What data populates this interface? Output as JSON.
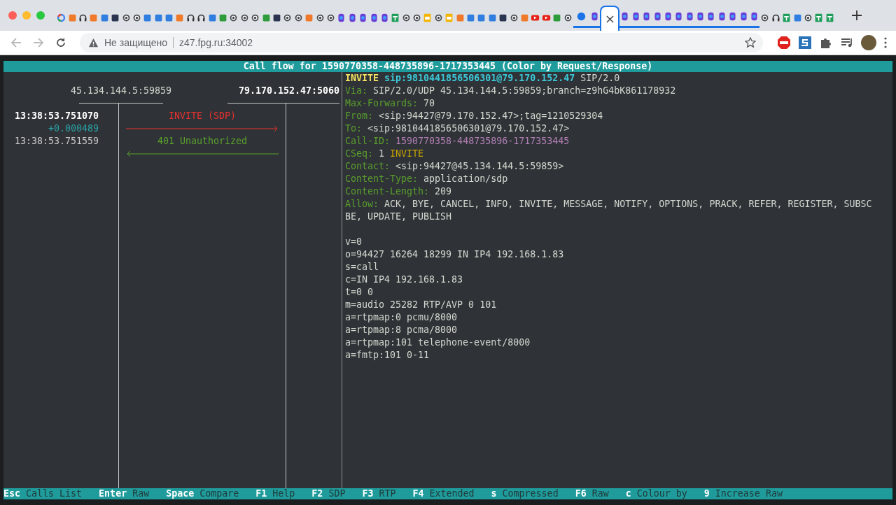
{
  "browser": {
    "tabs": [
      {
        "kind": "google",
        "selected": false,
        "grouped": false
      },
      {
        "kind": "orange",
        "selected": false,
        "grouped": false
      },
      {
        "kind": "headphones",
        "selected": false,
        "grouped": false
      },
      {
        "kind": "orange",
        "selected": false,
        "grouped": false
      },
      {
        "kind": "blue",
        "selected": false,
        "grouped": false
      },
      {
        "kind": "dark",
        "selected": false,
        "grouped": false
      },
      {
        "kind": "swirl",
        "selected": false,
        "grouped": false
      },
      {
        "kind": "swirl",
        "selected": false,
        "grouped": false
      },
      {
        "kind": "blue",
        "selected": false,
        "grouped": false
      },
      {
        "kind": "blue",
        "selected": false,
        "grouped": false
      },
      {
        "kind": "blue",
        "selected": false,
        "grouped": false
      },
      {
        "kind": "orange",
        "selected": false,
        "grouped": false
      },
      {
        "kind": "headphones",
        "selected": false,
        "grouped": false
      },
      {
        "kind": "headphones",
        "selected": false,
        "grouped": false
      },
      {
        "kind": "blue",
        "selected": false,
        "grouped": false
      },
      {
        "kind": "green",
        "selected": false,
        "grouped": false
      },
      {
        "kind": "swirl",
        "selected": false,
        "grouped": false
      },
      {
        "kind": "swirl",
        "selected": false,
        "grouped": false
      },
      {
        "kind": "swirl",
        "selected": false,
        "grouped": false
      },
      {
        "kind": "green",
        "selected": false,
        "grouped": false
      },
      {
        "kind": "dark",
        "selected": false,
        "grouped": false
      },
      {
        "kind": "swirl",
        "selected": false,
        "grouped": false
      },
      {
        "kind": "swirl",
        "selected": false,
        "grouped": false
      },
      {
        "kind": "orange",
        "selected": false,
        "grouped": false
      },
      {
        "kind": "swirl",
        "selected": false,
        "grouped": false
      },
      {
        "kind": "swirl",
        "selected": false,
        "grouped": false
      },
      {
        "kind": "purple",
        "selected": false,
        "grouped": false
      },
      {
        "kind": "purple",
        "selected": false,
        "grouped": false
      },
      {
        "kind": "purple",
        "selected": false,
        "grouped": false
      },
      {
        "kind": "purple",
        "selected": false,
        "grouped": false
      },
      {
        "kind": "purple",
        "selected": false,
        "grouped": false
      },
      {
        "kind": "sheet",
        "selected": false,
        "grouped": false
      },
      {
        "kind": "swirl",
        "selected": false,
        "grouped": false
      },
      {
        "kind": "swirl",
        "selected": false,
        "grouped": false
      },
      {
        "kind": "slide",
        "selected": false,
        "grouped": false
      },
      {
        "kind": "swirl",
        "selected": false,
        "grouped": false
      },
      {
        "kind": "slide",
        "selected": false,
        "grouped": false
      },
      {
        "kind": "orange",
        "selected": false,
        "grouped": false
      },
      {
        "kind": "blue",
        "selected": false,
        "grouped": false
      },
      {
        "kind": "blue",
        "selected": false,
        "grouped": false
      },
      {
        "kind": "blue",
        "selected": false,
        "grouped": false
      },
      {
        "kind": "dark",
        "selected": false,
        "grouped": false
      },
      {
        "kind": "swirl",
        "selected": false,
        "grouped": false
      },
      {
        "kind": "orange",
        "selected": false,
        "grouped": false
      },
      {
        "kind": "youtube",
        "selected": false,
        "grouped": false
      },
      {
        "kind": "youtube",
        "selected": false,
        "grouped": false
      },
      {
        "kind": "green",
        "selected": false,
        "grouped": false
      },
      {
        "kind": "swirl",
        "selected": false,
        "grouped": false
      },
      {
        "kind": "dot",
        "selected": false,
        "grouped": true
      },
      {
        "kind": "purple",
        "selected": false,
        "grouped": true
      },
      {
        "kind": "purple",
        "selected": true,
        "grouped": true
      },
      {
        "kind": "purple",
        "selected": false,
        "grouped": true
      },
      {
        "kind": "purple",
        "selected": false,
        "grouped": true
      },
      {
        "kind": "purple",
        "selected": false,
        "grouped": true
      },
      {
        "kind": "purple",
        "selected": false,
        "grouped": true
      },
      {
        "kind": "purple",
        "selected": false,
        "grouped": true
      },
      {
        "kind": "purple",
        "selected": false,
        "grouped": true
      },
      {
        "kind": "purple",
        "selected": false,
        "grouped": true
      },
      {
        "kind": "purple",
        "selected": false,
        "grouped": true
      },
      {
        "kind": "purple",
        "selected": false,
        "grouped": true
      },
      {
        "kind": "purple",
        "selected": false,
        "grouped": true
      },
      {
        "kind": "purple",
        "selected": false,
        "grouped": true
      },
      {
        "kind": "purple",
        "selected": false,
        "grouped": true
      },
      {
        "kind": "purple",
        "selected": false,
        "grouped": true
      },
      {
        "kind": "swirl",
        "selected": false,
        "grouped": false
      },
      {
        "kind": "headphones",
        "selected": false,
        "grouped": false
      },
      {
        "kind": "sheet",
        "selected": false,
        "grouped": false
      },
      {
        "kind": "blue",
        "selected": false,
        "grouped": false
      },
      {
        "kind": "swirl",
        "selected": false,
        "grouped": false
      },
      {
        "kind": "sheet",
        "selected": false,
        "grouped": false
      },
      {
        "kind": "sheet",
        "selected": false,
        "grouped": false
      }
    ],
    "address_bar": {
      "security_label": "Не защищено",
      "url": "z47.fpg.ru:34002"
    }
  },
  "terminal": {
    "title": "Call flow for 1590770358-448735896-1717353445 (Color by Request/Response)",
    "hosts": [
      {
        "address": "45.134.144.5:59859",
        "selected": false
      },
      {
        "address": "79.170.152.47:5060",
        "selected": true
      }
    ],
    "messages": [
      {
        "time": "13:38:53.751070",
        "delta": "+0.000489",
        "label": "INVITE (SDP)",
        "kind": "request",
        "color": "#e8302f",
        "selected": true
      },
      {
        "time": "13:38:53.751559",
        "label": "401 Unauthorized",
        "kind": "response",
        "color": "#5aa02c",
        "selected": false
      }
    ],
    "sip_lines": [
      [
        {
          "kind": "method",
          "text": "INVITE"
        },
        {
          "kind": "uri",
          "text": "sip:9810441856506301@79.170.152.47"
        },
        {
          "kind": "value",
          "text": "SIP/2.0"
        }
      ],
      [
        {
          "kind": "header",
          "text": "Via:"
        },
        {
          "kind": "value",
          "text": "SIP/2.0/UDP 45.134.144.5:59859;branch=z9hG4bK861178932"
        }
      ],
      [
        {
          "kind": "header",
          "text": "Max-Forwards:"
        },
        {
          "kind": "value",
          "text": "70"
        }
      ],
      [
        {
          "kind": "header",
          "text": "From:"
        },
        {
          "kind": "value",
          "text": "<sip:94427@79.170.152.47>;tag=1210529304"
        }
      ],
      [
        {
          "kind": "header",
          "text": "To:"
        },
        {
          "kind": "value",
          "text": "<sip:9810441856506301@79.170.152.47>"
        }
      ],
      [
        {
          "kind": "header",
          "text": "Call-ID:"
        },
        {
          "kind": "callid",
          "text": "1590770358-448735896-1717353445"
        }
      ],
      [
        {
          "kind": "header",
          "text": "CSeq:"
        },
        {
          "kind": "value",
          "text": "1"
        },
        {
          "kind": "cseq_method",
          "text": "INVITE"
        }
      ],
      [
        {
          "kind": "header",
          "text": "Contact:"
        },
        {
          "kind": "value",
          "text": "<sip:94427@45.134.144.5:59859>"
        }
      ],
      [
        {
          "kind": "header",
          "text": "Content-Type:"
        },
        {
          "kind": "value",
          "text": "application/sdp"
        }
      ],
      [
        {
          "kind": "header",
          "text": "Content-Length:"
        },
        {
          "kind": "value",
          "text": "209"
        }
      ],
      [
        {
          "kind": "header",
          "text": "Allow:"
        },
        {
          "kind": "value",
          "text": "ACK, BYE, CANCEL, INFO, INVITE, MESSAGE, NOTIFY, OPTIONS, PRACK, REFER, REGISTER, SUBSC"
        }
      ],
      [
        {
          "kind": "value",
          "text": "BE, UPDATE, PUBLISH"
        }
      ],
      [
        {
          "kind": "blank"
        }
      ],
      [
        {
          "kind": "value",
          "text": "v=0"
        }
      ],
      [
        {
          "kind": "value",
          "text": "o=94427 16264 18299 IN IP4 192.168.1.83"
        }
      ],
      [
        {
          "kind": "value",
          "text": "s=call"
        }
      ],
      [
        {
          "kind": "value",
          "text": "c=IN IP4 192.168.1.83"
        }
      ],
      [
        {
          "kind": "value",
          "text": "t=0 0"
        }
      ],
      [
        {
          "kind": "value",
          "text": "m=audio 25282 RTP/AVP 0 101"
        }
      ],
      [
        {
          "kind": "value",
          "text": "a=rtpmap:0 pcmu/8000"
        }
      ],
      [
        {
          "kind": "value",
          "text": "a=rtpmap:8 pcma/8000"
        }
      ],
      [
        {
          "kind": "value",
          "text": "a=rtpmap:101 telephone-event/8000"
        }
      ],
      [
        {
          "kind": "value",
          "text": "a=fmtp:101 0-11"
        }
      ]
    ],
    "keys": [
      {
        "key": "Esc",
        "label": "Calls List"
      },
      {
        "key": "Enter",
        "label": "Raw"
      },
      {
        "key": "Space",
        "label": "Compare"
      },
      {
        "key": "F1",
        "label": "Help"
      },
      {
        "key": "F2",
        "label": "SDP"
      },
      {
        "key": "F3",
        "label": "RTP"
      },
      {
        "key": "F4",
        "label": "Extended"
      },
      {
        "key": "s",
        "label": "Compressed"
      },
      {
        "key": "F6",
        "label": "Raw"
      },
      {
        "key": "c",
        "label": "Colour by"
      },
      {
        "key": "9",
        "label": "Increase Raw"
      }
    ]
  }
}
